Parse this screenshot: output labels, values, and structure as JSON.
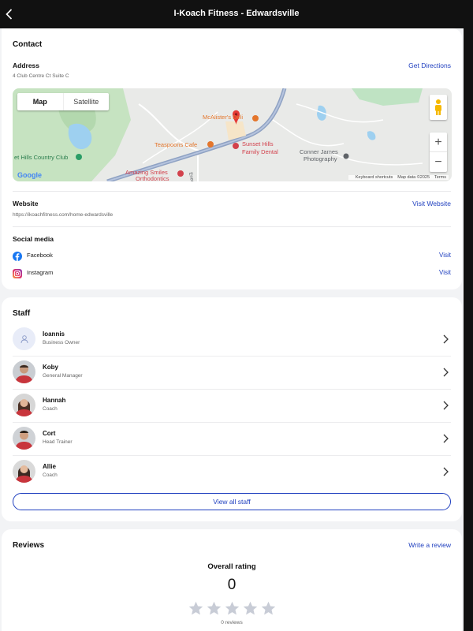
{
  "header": {
    "title": "I-Koach Fitness - Edwardsville"
  },
  "contact": {
    "heading": "Contact",
    "address_label": "Address",
    "address_value": "4 Club Centre Ct Suite C",
    "directions_link": "Get Directions",
    "map": {
      "map_tab": "Map",
      "satellite_tab": "Satellite",
      "zoom_in": "+",
      "zoom_out": "−",
      "logo": "Google",
      "keyboard_shortcuts": "Keyboard shortcuts",
      "map_data": "Map data ©2025",
      "terms": "Terms",
      "places": {
        "mcalisters": "McAlister's Deli",
        "teaspoons": "Teaspoons Cafe",
        "sunset_hills_1": "Sunset Hills",
        "sunset_hills_2": "Family Dental",
        "country_club": "et Hills Country Club",
        "conner_1": "Conner James",
        "conner_2": "Photography",
        "amazing_1": "Amazing Smiles",
        "amazing_2": "Orthodontics",
        "road": "Energ"
      }
    },
    "website_label": "Website",
    "website_value": "https://ikoachfitness.com/home-edwardsville",
    "website_link": "Visit Website",
    "social_label": "Social media",
    "social": [
      {
        "name": "Facebook",
        "action": "Visit",
        "icon": "facebook-icon"
      },
      {
        "name": "Instagram",
        "action": "Visit",
        "icon": "instagram-icon"
      }
    ]
  },
  "staff": {
    "heading": "Staff",
    "members": [
      {
        "name": "Ioannis",
        "role": "Business Owner"
      },
      {
        "name": "Koby",
        "role": "General Manager"
      },
      {
        "name": "Hannah",
        "role": "Coach"
      },
      {
        "name": "Cort",
        "role": "Head Trainer"
      },
      {
        "name": "Allie",
        "role": "Coach"
      }
    ],
    "view_all": "View all staff"
  },
  "reviews": {
    "heading": "Reviews",
    "write_link": "Write a review",
    "overall_label": "Overall rating",
    "rating": "0",
    "count_text": "0 reviews",
    "stars_filled": 0,
    "stars_total": 5
  },
  "colors": {
    "accent": "#1f3fbf",
    "topbar": "#111111",
    "star_empty": "#c8ccd6"
  }
}
